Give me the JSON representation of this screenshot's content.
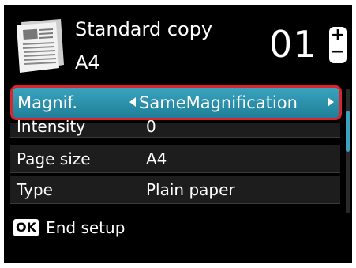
{
  "header": {
    "mode_title": "Standard copy",
    "paper_size": "A4",
    "copies": "01",
    "stepper_plus": "+",
    "stepper_minus": "−",
    "document_icon": "document-icon"
  },
  "menu": {
    "items": [
      {
        "label": "Magnif.",
        "value": "SameMagnification",
        "selected": true
      },
      {
        "label": "Intensity",
        "value": "0"
      },
      {
        "label": "Page size",
        "value": "A4"
      },
      {
        "label": "Type",
        "value": "Plain paper"
      }
    ]
  },
  "footer": {
    "key_label": "OK",
    "action_label": "End setup"
  },
  "colors": {
    "selected_row": "#2c94b0",
    "selection_border": "#d8262c",
    "row_background": "#1d1d1d",
    "screen_background": "#000000"
  }
}
